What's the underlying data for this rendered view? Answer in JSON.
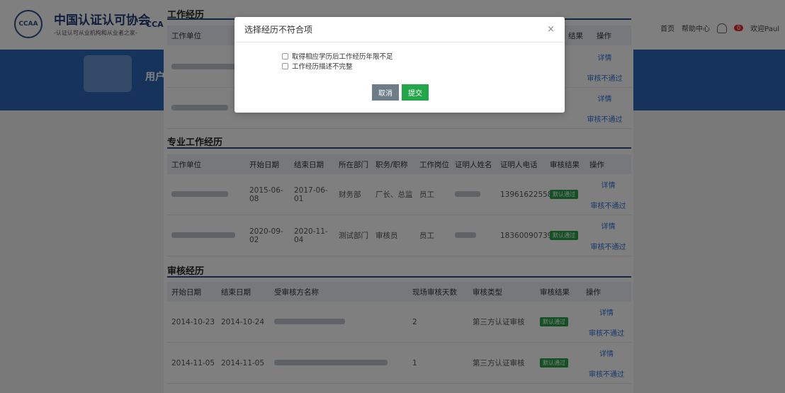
{
  "header": {
    "logo_text": "CCAA",
    "org_name": "中国认证认可协会",
    "org_sub": "-认证认可从业机构和从业者之家-",
    "brand_tail": "CCA",
    "links": [
      "首页",
      "帮助中心"
    ],
    "badge_count": "0",
    "user": "欢迎Paul"
  },
  "banner": {
    "title": "用户"
  },
  "sections": {
    "work_history": {
      "title": "工作经历",
      "col_company": "工作单位",
      "col_result_tail": "结果",
      "col_ops": "操作",
      "rows": [
        {
          "detail": "详情",
          "reject": "审核不通过"
        },
        {
          "detail": "详情",
          "reject": "审核不通过"
        }
      ]
    },
    "professional": {
      "title": "专业工作经历",
      "columns": [
        "工作单位",
        "开始日期",
        "结束日期",
        "所在部门",
        "职务/职称",
        "工作岗位",
        "证明人姓名",
        "证明人电话",
        "审核结果",
        "操作"
      ],
      "rows": [
        {
          "start": "2015-06-08",
          "end": "2017-06-01",
          "dept": "财务部",
          "title": "厂长、总监",
          "post": "员工",
          "phone": "13961622558",
          "status": "默认通过",
          "detail": "详情",
          "reject": "审核不通过"
        },
        {
          "start": "2020-09-02",
          "end": "2020-11-04",
          "dept": "测试部门",
          "title": "审核员",
          "post": "员工",
          "phone": "18360090739",
          "status": "默认通过",
          "detail": "详情",
          "reject": "审核不通过"
        }
      ]
    },
    "audit": {
      "title": "审核经历",
      "columns": [
        "开始日期",
        "结束日期",
        "受审核方名称",
        "现场审核天数",
        "审核类型",
        "审核结果",
        "操作"
      ],
      "rows": [
        {
          "start": "2014-10-23",
          "end": "2014-10-24",
          "days": "2",
          "type": "第三方认证审核",
          "status": "默认通过",
          "detail": "详情",
          "reject": "审核不通过"
        },
        {
          "start": "2014-11-05",
          "end": "2014-11-05",
          "days": "1",
          "type": "第三方认证审核",
          "status": "默认通过",
          "detail": "详情",
          "reject": "审核不通过"
        }
      ]
    }
  },
  "modal": {
    "title": "选择经历不符合项",
    "close": "×",
    "options": [
      "取得相应学历后工作经历年限不足",
      "工作经历描述不完整"
    ],
    "cancel": "取消",
    "submit": "提交"
  }
}
